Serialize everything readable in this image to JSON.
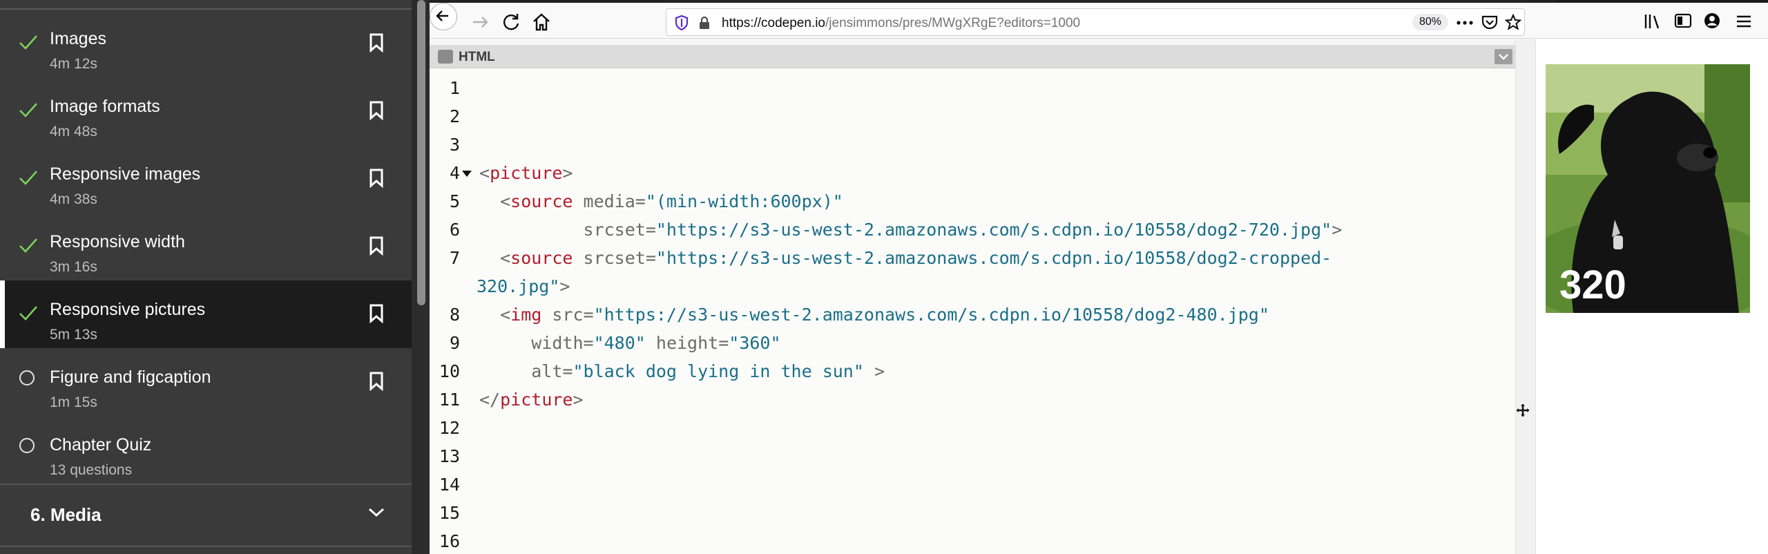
{
  "sidebar": {
    "lessons": [
      {
        "title": "Images",
        "duration": "4m 12s",
        "completed": true,
        "active": false
      },
      {
        "title": "Image formats",
        "duration": "4m 48s",
        "completed": true,
        "active": false
      },
      {
        "title": "Responsive images",
        "duration": "4m 38s",
        "completed": true,
        "active": false
      },
      {
        "title": "Responsive width",
        "duration": "3m 16s",
        "completed": true,
        "active": false
      },
      {
        "title": "Responsive pictures",
        "duration": "5m 13s",
        "completed": true,
        "active": true
      },
      {
        "title": "Figure and figcaption",
        "duration": "1m 15s",
        "completed": false,
        "active": false
      },
      {
        "title": "Chapter Quiz",
        "duration": "13 questions",
        "completed": false,
        "active": false
      }
    ],
    "chapter": {
      "title": "6. Media"
    }
  },
  "browser": {
    "url_host": "https://codepen.io",
    "url_path": "/jensimmons/pres/MWgXRgE?editors=1000",
    "zoom": "80%"
  },
  "editor": {
    "language": "HTML",
    "line_numbers": [
      "1",
      "2",
      "3",
      "4",
      "5",
      "6",
      "7",
      "",
      "8",
      "9",
      "10",
      "11",
      "12",
      "13",
      "14",
      "15",
      "16"
    ],
    "code": {
      "l4_open": "<",
      "l4_tag": "picture",
      "l4_close": ">",
      "l5_indent": "  <",
      "l5_tag": "source",
      "l5_attr": " media=",
      "l5_val": "\"(min-width:600px)\"",
      "l6_attr": "          srcset=",
      "l6_val": "\"https://s3-us-west-2.amazonaws.com/s.cdpn.io/10558/dog2-720.jpg\"",
      "l6_close": ">",
      "l7_indent": "  <",
      "l7_tag": "source",
      "l7_attr": " srcset=",
      "l7_val": "\"https://s3-us-west-2.amazonaws.com/s.cdpn.io/10558/dog2-cropped-",
      "l7b_val": "320.jpg\"",
      "l7b_close": ">",
      "l8_indent": "  <",
      "l8_tag": "img",
      "l8_attr": " src=",
      "l8_val": "\"https://s3-us-west-2.amazonaws.com/s.cdpn.io/10558/dog2-480.jpg\"",
      "l9_attr1": "     width=",
      "l9_val1": "\"480\"",
      "l9_attr2": " height=",
      "l9_val2": "\"360\"",
      "l10_attr": "     alt=",
      "l10_val": "\"black dog lying in the sun\"",
      "l10_close": " >",
      "l11_open": "</",
      "l11_tag": "picture",
      "l11_close": ">"
    }
  },
  "preview": {
    "image_label": "320",
    "image_alt": "black dog lying in the sun"
  },
  "colors": {
    "tag": "#b01f2a",
    "attr_value": "#1a6f88",
    "check": "#7dd35a"
  }
}
